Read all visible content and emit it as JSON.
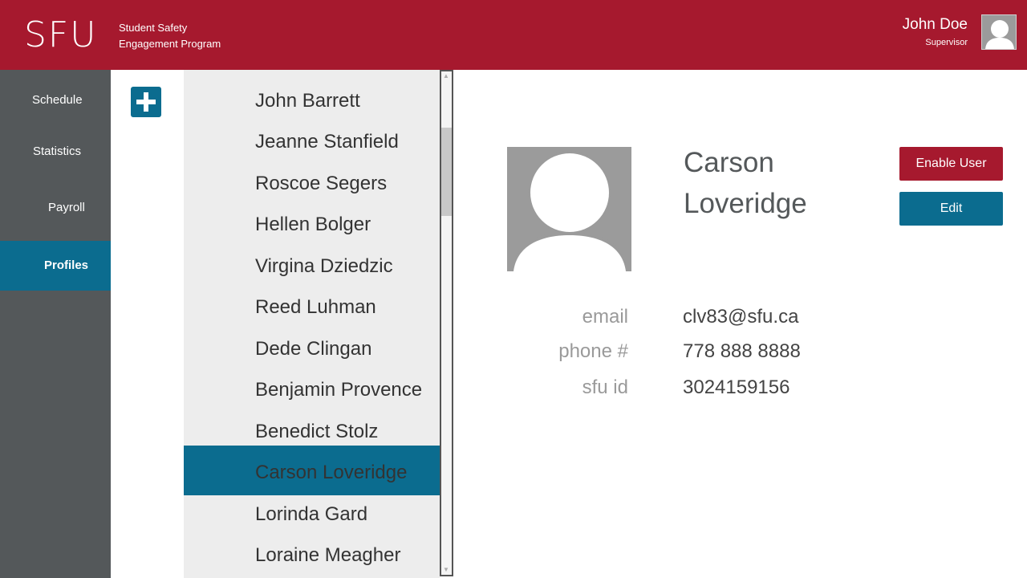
{
  "header": {
    "logo": "SFU",
    "program_line1": "Student Safety",
    "program_line2": "Engagement Program",
    "user_name": "John Doe",
    "user_role": "Supervisor",
    "brand_color": "#a6192e"
  },
  "sidebar": {
    "items": [
      {
        "label": "Schedule",
        "active": false
      },
      {
        "label": "Statistics",
        "active": false
      },
      {
        "label": "Payroll",
        "active": false
      },
      {
        "label": "Profiles",
        "active": true
      }
    ],
    "background": "#54585a",
    "active_color": "#0b6c8f"
  },
  "add_button": {
    "icon": "plus-icon"
  },
  "profile_list": {
    "items": [
      "John Barrett",
      "Jeanne Stanfield",
      "Roscoe Segers",
      "Hellen Bolger",
      "Virgina Dziedzic",
      "Reed Luhman",
      "Dede Clingan",
      "Benjamin Provence",
      "Benedict Stolz",
      "Carson Loveridge",
      "Lorinda Gard",
      "Loraine Meagher"
    ],
    "selected": "Carson Loveridge"
  },
  "profile": {
    "first_name": "Carson",
    "last_name": "Loveridge",
    "enable_label": "Enable User",
    "edit_label": "Edit",
    "fields": [
      {
        "label": "email",
        "value": "clv83@sfu.ca"
      },
      {
        "label": "phone #",
        "value": "778 888 8888"
      },
      {
        "label": "sfu id",
        "value": "3024159156"
      }
    ]
  }
}
